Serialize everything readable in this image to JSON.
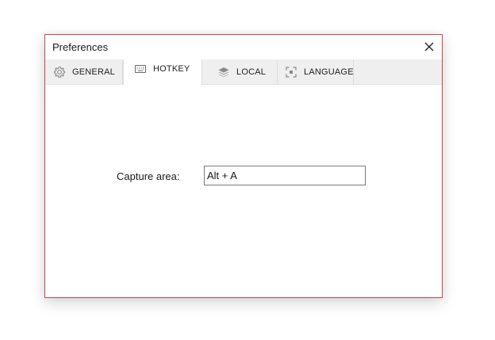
{
  "window": {
    "title": "Preferences",
    "close_icon": "close-icon"
  },
  "tabs": [
    {
      "label": "GENERAL",
      "icon": "gear-icon",
      "active": false
    },
    {
      "label": "HOTKEY",
      "icon": "keyboard-icon",
      "active": true
    },
    {
      "label": "LOCAL",
      "icon": "layers-icon",
      "active": false
    },
    {
      "label": "LANGUAGE",
      "icon": "capture-frame-icon",
      "active": false
    }
  ],
  "hotkey": {
    "capture_label": "Capture area:",
    "capture_value": "Alt + A"
  },
  "colors": {
    "window_border": "#c9484b",
    "tabbar_bg": "#efefef",
    "input_border": "#7a7a7a"
  }
}
